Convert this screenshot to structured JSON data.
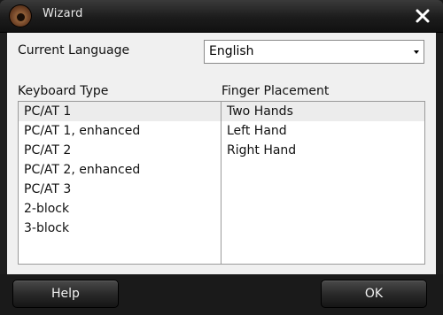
{
  "window": {
    "title": "Wizard"
  },
  "language": {
    "label": "Current Language",
    "selected": "English"
  },
  "keyboard": {
    "label": "Keyboard Type",
    "items": [
      "PC/AT 1",
      "PC/AT 1, enhanced",
      "PC/AT 2",
      "PC/AT 2, enhanced",
      "PC/AT 3",
      "2-block",
      "3-block"
    ],
    "selected_index": 0
  },
  "fingers": {
    "label": "Finger Placement",
    "items": [
      "Two Hands",
      "Left Hand",
      "Right Hand"
    ],
    "selected_index": 0
  },
  "footer": {
    "help_label": "Help",
    "ok_label": "OK"
  },
  "icons": {
    "app": "eye-app-icon",
    "close": "close-icon",
    "dropdown": "dropdown-arrow-icon"
  },
  "colors": {
    "chrome": "#1e1e1e",
    "panel": "#f0f0f0",
    "selected_row": "#ececec"
  }
}
